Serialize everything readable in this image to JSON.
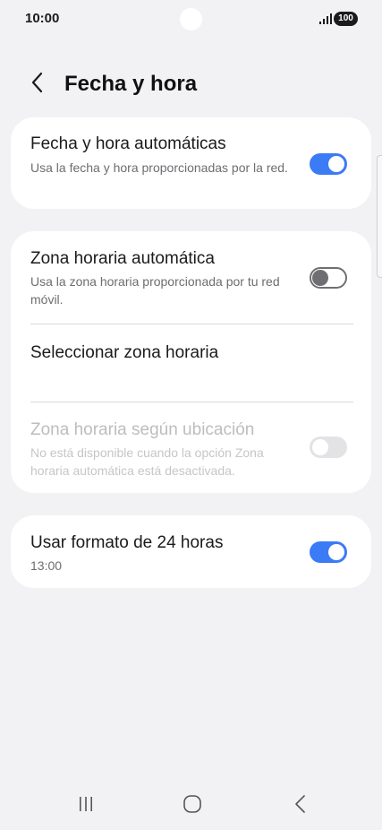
{
  "status_bar": {
    "time": "10:00",
    "battery": "100"
  },
  "header": {
    "title": "Fecha y hora"
  },
  "settings": {
    "auto_datetime": {
      "title": "Fecha y hora automáticas",
      "subtitle": "Usa la fecha y hora proporcionadas por la red.",
      "enabled": true
    },
    "auto_timezone": {
      "title": "Zona horaria automática",
      "subtitle": "Usa la zona horaria proporcionada por tu red móvil.",
      "enabled": false
    },
    "select_timezone": {
      "title": "Seleccionar zona horaria"
    },
    "location_timezone": {
      "title": "Zona horaria según ubicación",
      "subtitle": "No está disponible cuando la opción Zona horaria automática está desactivada.",
      "enabled": false,
      "disabled": true
    },
    "format_24h": {
      "title": "Usar formato de 24 horas",
      "subtitle": "13:00",
      "enabled": true
    }
  },
  "colors": {
    "background": "#f2f2f4",
    "card": "#ffffff",
    "accent": "#3b7bf5",
    "toggle_off": "#6f6f73",
    "disabled_text": "#bdbdc1"
  },
  "icons": {
    "back": "chevron-left-icon",
    "signal": "signal-icon",
    "nav_recents": "recents-icon",
    "nav_home": "home-icon",
    "nav_back": "back-icon"
  }
}
